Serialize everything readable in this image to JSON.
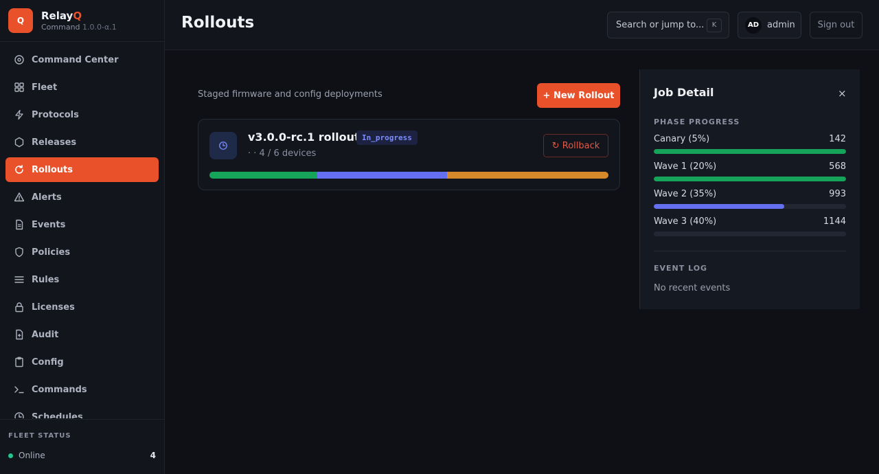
{
  "brand": {
    "logo_letter": "Q",
    "name_main": "Relay",
    "name_accent": "Q",
    "subtitle": "Command",
    "version": "1.0.0-α.1",
    "accent_color": "#e8512a"
  },
  "sidebar": {
    "items": [
      {
        "label": "Command Center",
        "icon": "target-icon",
        "active": false
      },
      {
        "label": "Fleet",
        "icon": "grid-icon",
        "active": false
      },
      {
        "label": "Protocols",
        "icon": "bolt-icon",
        "active": false
      },
      {
        "label": "Releases",
        "icon": "hexagon-icon",
        "active": false
      },
      {
        "label": "Rollouts",
        "icon": "refresh-icon",
        "active": true
      },
      {
        "label": "Alerts",
        "icon": "warning-icon",
        "active": false
      },
      {
        "label": "Events",
        "icon": "document-icon",
        "active": false
      },
      {
        "label": "Policies",
        "icon": "shield-icon",
        "active": false
      },
      {
        "label": "Rules",
        "icon": "menu-icon",
        "active": false
      },
      {
        "label": "Licenses",
        "icon": "lock-icon",
        "active": false
      },
      {
        "label": "Audit",
        "icon": "file-plus-icon",
        "active": false
      },
      {
        "label": "Config",
        "icon": "clipboard-icon",
        "active": false
      },
      {
        "label": "Commands",
        "icon": "terminal-icon",
        "active": false
      },
      {
        "label": "Schedules",
        "icon": "clock-icon",
        "active": false
      }
    ]
  },
  "fleet_status": {
    "title": "FLEET STATUS",
    "online_label": "Online",
    "online_count": "4",
    "online_color": "#22c58b"
  },
  "header": {
    "title": "Rollouts",
    "search_placeholder": "Search or jump to...",
    "search_shortcut": "K",
    "user_initials": "AD",
    "user_name": "admin",
    "signout_label": "Sign out"
  },
  "main": {
    "subtitle": "Staged firmware and config deployments",
    "new_button": "+ New Rollout"
  },
  "rollout": {
    "icon": "clock-icon",
    "title": "v3.0.0-rc.1 rollout",
    "status": "In_progress",
    "meta": "· · 4 / 6 devices",
    "rollback_label": "↻ Rollback",
    "segments": [
      {
        "fraction": 0.27,
        "color": "#16a35a"
      },
      {
        "fraction": 0.325,
        "color": "#6470ef"
      },
      {
        "fraction": 0.405,
        "color": "#d6892a"
      }
    ]
  },
  "job_detail": {
    "title": "Job Detail",
    "close_label": "×",
    "phase_label": "PHASE PROGRESS",
    "phases": [
      {
        "name": "Canary (5%)",
        "count": "142",
        "progress": 1.0,
        "color": "#16a35a"
      },
      {
        "name": "Wave 1 (20%)",
        "count": "568",
        "progress": 1.0,
        "color": "#16a35a"
      },
      {
        "name": "Wave 2 (35%)",
        "count": "993",
        "progress": 0.68,
        "color": "#6470ef"
      },
      {
        "name": "Wave 3 (40%)",
        "count": "1144",
        "progress": 0.0,
        "color": "#6470ef"
      }
    ],
    "event_label": "EVENT LOG",
    "empty_events": "No recent events"
  }
}
